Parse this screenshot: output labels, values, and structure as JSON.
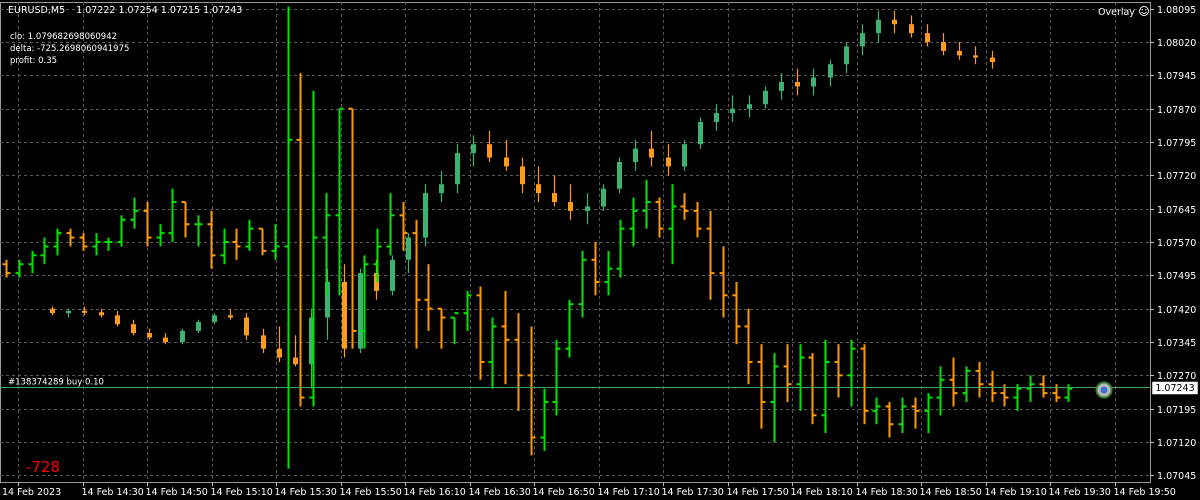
{
  "header": {
    "symbol": "EURUSD,M5",
    "ohlc": "1.07222 1.07254 1.07215 1.07243",
    "overlay_label": "Overlay"
  },
  "indicators": {
    "line1": "clo: 1.079682698060942",
    "line2": "delta: -725.2698060941975",
    "line3": "profit: 0.35"
  },
  "order_label": "#138374289 buy 0.10",
  "current_price_label": "1.07243",
  "delta_display": "-728",
  "colors": {
    "background": "#000000",
    "grid": "#5a5a5a",
    "bull_green": "#00e600",
    "bear_orange": "#ff9900",
    "overlay_bull": "#3cb371",
    "overlay_bear": "#ff9a1a",
    "order_line": "#3fa55a",
    "delta_text": "#ff0000"
  },
  "chart_data": {
    "type": "candlestick",
    "symbol": "EURUSD",
    "timeframe": "M5",
    "y_axis_ticks": [
      "1.08095",
      "1.08020",
      "1.07945",
      "1.07870",
      "1.07795",
      "1.07720",
      "1.07645",
      "1.07570",
      "1.07495",
      "1.07420",
      "1.07345",
      "1.07270",
      "1.07195",
      "1.07120",
      "1.07045"
    ],
    "y_range": [
      1.0703,
      1.0811
    ],
    "x_axis_ticks": [
      "14 Feb 2023",
      "14 Feb 14:30",
      "14 Feb 14:50",
      "14 Feb 15:10",
      "14 Feb 15:30",
      "14 Feb 15:50",
      "14 Feb 16:10",
      "14 Feb 16:30",
      "14 Feb 16:50",
      "14 Feb 17:10",
      "14 Feb 17:30",
      "14 Feb 17:50",
      "14 Feb 18:10",
      "14 Feb 18:30",
      "14 Feb 18:50",
      "14 Feb 19:10",
      "14 Feb 19:30",
      "14 Feb 19:50"
    ],
    "price_bars": [
      [
        1.0752,
        1.0753,
        1.0749,
        1.075
      ],
      [
        1.075,
        1.0753,
        1.0749,
        1.0752
      ],
      [
        1.0752,
        1.0755,
        1.075,
        1.0754
      ],
      [
        1.0754,
        1.0758,
        1.0752,
        1.0756
      ],
      [
        1.0756,
        1.076,
        1.0754,
        1.0759
      ],
      [
        1.0759,
        1.076,
        1.0756,
        1.0758
      ],
      [
        1.0758,
        1.0759,
        1.0755,
        1.0756
      ],
      [
        1.0756,
        1.0759,
        1.0754,
        1.0757
      ],
      [
        1.0757,
        1.0758,
        1.0755,
        1.0757
      ],
      [
        1.0757,
        1.0763,
        1.0756,
        1.0762
      ],
      [
        1.0762,
        1.0767,
        1.076,
        1.0764
      ],
      [
        1.0764,
        1.0766,
        1.0756,
        1.0758
      ],
      [
        1.0758,
        1.0761,
        1.0756,
        1.0759
      ],
      [
        1.0759,
        1.0769,
        1.0757,
        1.0766
      ],
      [
        1.0766,
        1.0766,
        1.0758,
        1.0761
      ],
      [
        1.0761,
        1.0763,
        1.0756,
        1.0761
      ],
      [
        1.0761,
        1.0764,
        1.0751,
        1.0754
      ],
      [
        1.0754,
        1.076,
        1.0752,
        1.0757
      ],
      [
        1.0757,
        1.076,
        1.0753,
        1.0756
      ],
      [
        1.0756,
        1.0762,
        1.0755,
        1.076
      ],
      [
        1.076,
        1.076,
        1.0754,
        1.0755
      ],
      [
        1.0755,
        1.0761,
        1.0753,
        1.0756
      ],
      [
        1.0756,
        1.081,
        1.0706,
        1.078
      ],
      [
        1.078,
        1.0795,
        1.072,
        1.0722
      ],
      [
        1.0722,
        1.0791,
        1.072,
        1.0758
      ],
      [
        1.0758,
        1.0768,
        1.0745,
        1.0763
      ],
      [
        1.0763,
        1.0787,
        1.0745,
        1.0787
      ],
      [
        1.0787,
        1.0787,
        1.0733,
        1.0737
      ],
      [
        1.0737,
        1.0754,
        1.0733,
        1.0752
      ],
      [
        1.0752,
        1.076,
        1.0748,
        1.0756
      ],
      [
        1.0756,
        1.0768,
        1.0754,
        1.0763
      ],
      [
        1.0763,
        1.0766,
        1.0755,
        1.0759
      ],
      [
        1.0759,
        1.0762,
        1.0733,
        1.0744
      ],
      [
        1.0744,
        1.0752,
        1.0737,
        1.0742
      ],
      [
        1.0742,
        1.0742,
        1.0733,
        1.074
      ],
      [
        1.074,
        1.074,
        1.0734,
        1.0741
      ],
      [
        1.0741,
        1.0746,
        1.0737,
        1.0745
      ],
      [
        1.0745,
        1.0747,
        1.0726,
        1.073
      ],
      [
        1.073,
        1.074,
        1.0724,
        1.0738
      ],
      [
        1.0738,
        1.0746,
        1.0725,
        1.0735
      ],
      [
        1.0735,
        1.0741,
        1.0719,
        1.0727
      ],
      [
        1.0727,
        1.0738,
        1.0709,
        1.0713
      ],
      [
        1.0713,
        1.0724,
        1.071,
        1.0721
      ],
      [
        1.0721,
        1.0735,
        1.0718,
        1.0733
      ],
      [
        1.0733,
        1.0744,
        1.0731,
        1.0743
      ],
      [
        1.0743,
        1.0755,
        1.074,
        1.0753
      ],
      [
        1.0753,
        1.0757,
        1.0745,
        1.0748
      ],
      [
        1.0748,
        1.0755,
        1.0745,
        1.0751
      ],
      [
        1.0751,
        1.0762,
        1.0749,
        1.076
      ],
      [
        1.076,
        1.0767,
        1.0756,
        1.0764
      ],
      [
        1.0764,
        1.0771,
        1.076,
        1.0766
      ],
      [
        1.0766,
        1.0767,
        1.0758,
        1.076
      ],
      [
        1.076,
        1.077,
        1.0752,
        1.0765
      ],
      [
        1.0765,
        1.0768,
        1.0762,
        1.0764
      ],
      [
        1.0764,
        1.0766,
        1.0758,
        1.076
      ],
      [
        1.076,
        1.0764,
        1.0744,
        1.075
      ],
      [
        1.075,
        1.0756,
        1.074,
        1.0745
      ],
      [
        1.0745,
        1.0748,
        1.0734,
        1.0738
      ],
      [
        1.0738,
        1.0742,
        1.0725,
        1.073
      ],
      [
        1.073,
        1.0734,
        1.0715,
        1.0721
      ],
      [
        1.0721,
        1.0732,
        1.0712,
        1.0729
      ],
      [
        1.0729,
        1.0734,
        1.0721,
        1.0725
      ],
      [
        1.0725,
        1.0734,
        1.0719,
        1.0731
      ],
      [
        1.0731,
        1.0732,
        1.0716,
        1.0718
      ],
      [
        1.0718,
        1.0735,
        1.0714,
        1.073
      ],
      [
        1.073,
        1.0734,
        1.0722,
        1.0727
      ],
      [
        1.0727,
        1.0735,
        1.072,
        1.0733
      ],
      [
        1.0733,
        1.0734,
        1.0716,
        1.0719
      ],
      [
        1.0719,
        1.0722,
        1.0716,
        1.072
      ],
      [
        1.072,
        1.0721,
        1.0713,
        1.0716
      ],
      [
        1.0716,
        1.0722,
        1.0714,
        1.072
      ],
      [
        1.072,
        1.0722,
        1.0715,
        1.0719
      ],
      [
        1.0719,
        1.0723,
        1.0714,
        1.0722
      ],
      [
        1.0722,
        1.0729,
        1.0718,
        1.0726
      ],
      [
        1.0726,
        1.0731,
        1.072,
        1.0723
      ],
      [
        1.0723,
        1.0729,
        1.0721,
        1.0728
      ],
      [
        1.0728,
        1.073,
        1.0722,
        1.0725
      ],
      [
        1.0725,
        1.0728,
        1.0721,
        1.0723
      ],
      [
        1.0723,
        1.0725,
        1.072,
        1.0722
      ],
      [
        1.0722,
        1.0725,
        1.0719,
        1.0724
      ],
      [
        1.0724,
        1.0727,
        1.0721,
        1.0725
      ],
      [
        1.0725,
        1.0727,
        1.0722,
        1.0723
      ],
      [
        1.0723,
        1.0725,
        1.0721,
        1.0722
      ],
      [
        1.0722,
        1.0725,
        1.0721,
        1.0724
      ]
    ],
    "overlay_bars": [
      [
        1.0742,
        1.07425,
        1.07405,
        1.0741
      ],
      [
        1.0741,
        1.0742,
        1.074,
        1.07415
      ],
      [
        1.07415,
        1.07425,
        1.07405,
        1.07412
      ],
      [
        1.07412,
        1.0742,
        1.074,
        1.07405
      ],
      [
        1.07405,
        1.07415,
        1.0738,
        1.07385
      ],
      [
        1.07385,
        1.07395,
        1.0736,
        1.07365
      ],
      [
        1.07365,
        1.07375,
        1.0735,
        1.07355
      ],
      [
        1.07355,
        1.07365,
        1.0734,
        1.07345
      ],
      [
        1.07345,
        1.07375,
        1.0734,
        1.0737
      ],
      [
        1.0737,
        1.07395,
        1.07365,
        1.0739
      ],
      [
        1.0739,
        1.0741,
        1.07385,
        1.07405
      ],
      [
        1.07405,
        1.0742,
        1.07395,
        1.074
      ],
      [
        1.074,
        1.0741,
        1.0735,
        1.0736
      ],
      [
        1.0736,
        1.07375,
        1.0732,
        1.0733
      ],
      [
        1.0733,
        1.0738,
        1.073,
        1.0731
      ],
      [
        1.0731,
        1.0736,
        1.0729,
        1.07295
      ],
      [
        1.07295,
        1.0742,
        1.0724,
        1.074
      ],
      [
        1.074,
        1.0751,
        1.0735,
        1.0748
      ],
      [
        1.0748,
        1.0752,
        1.0731,
        1.0733
      ],
      [
        1.0733,
        1.0751,
        1.0732,
        1.075
      ],
      [
        1.075,
        1.0753,
        1.0744,
        1.0746
      ],
      [
        1.0746,
        1.0754,
        1.0745,
        1.0753
      ],
      [
        1.0753,
        1.0759,
        1.075,
        1.0758
      ],
      [
        1.0758,
        1.077,
        1.0756,
        1.0768
      ],
      [
        1.0768,
        1.0773,
        1.0766,
        1.077
      ],
      [
        1.077,
        1.0779,
        1.0768,
        1.0777
      ],
      [
        1.0777,
        1.0781,
        1.0774,
        1.0779
      ],
      [
        1.0779,
        1.0782,
        1.0775,
        1.0776
      ],
      [
        1.0776,
        1.078,
        1.0773,
        1.0774
      ],
      [
        1.0774,
        1.0776,
        1.0768,
        1.077
      ],
      [
        1.077,
        1.0774,
        1.0766,
        1.0768
      ],
      [
        1.0768,
        1.0772,
        1.0765,
        1.0766
      ],
      [
        1.0766,
        1.077,
        1.0762,
        1.0764
      ],
      [
        1.0764,
        1.0768,
        1.0761,
        1.0765
      ],
      [
        1.0765,
        1.077,
        1.0764,
        1.0769
      ],
      [
        1.0769,
        1.0776,
        1.0768,
        1.0775
      ],
      [
        1.0775,
        1.078,
        1.0773,
        1.0778
      ],
      [
        1.0778,
        1.0782,
        1.0774,
        1.0776
      ],
      [
        1.0776,
        1.0779,
        1.0772,
        1.0774
      ],
      [
        1.0774,
        1.078,
        1.0773,
        1.0779
      ],
      [
        1.0779,
        1.0785,
        1.0778,
        1.0784
      ],
      [
        1.0784,
        1.0788,
        1.0782,
        1.0786
      ],
      [
        1.0786,
        1.079,
        1.0784,
        1.0787
      ],
      [
        1.0787,
        1.079,
        1.0785,
        1.0788
      ],
      [
        1.0788,
        1.0792,
        1.0787,
        1.0791
      ],
      [
        1.0791,
        1.0795,
        1.0789,
        1.0793
      ],
      [
        1.0793,
        1.0796,
        1.079,
        1.0792
      ],
      [
        1.0792,
        1.0796,
        1.079,
        1.0794
      ],
      [
        1.0794,
        1.0798,
        1.0792,
        1.0797
      ],
      [
        1.0797,
        1.0802,
        1.0795,
        1.0801
      ],
      [
        1.0801,
        1.0806,
        1.0799,
        1.0804
      ],
      [
        1.0804,
        1.0809,
        1.0802,
        1.0807
      ],
      [
        1.0807,
        1.0809,
        1.0804,
        1.0806
      ],
      [
        1.0806,
        1.0808,
        1.0803,
        1.0804
      ],
      [
        1.0804,
        1.0806,
        1.0801,
        1.0802
      ],
      [
        1.0802,
        1.0804,
        1.0799,
        1.08
      ],
      [
        1.08,
        1.0802,
        1.0798,
        1.0799
      ],
      [
        1.0799,
        1.0801,
        1.0797,
        1.07985
      ],
      [
        1.07985,
        1.08,
        1.0796,
        1.07975
      ]
    ]
  }
}
